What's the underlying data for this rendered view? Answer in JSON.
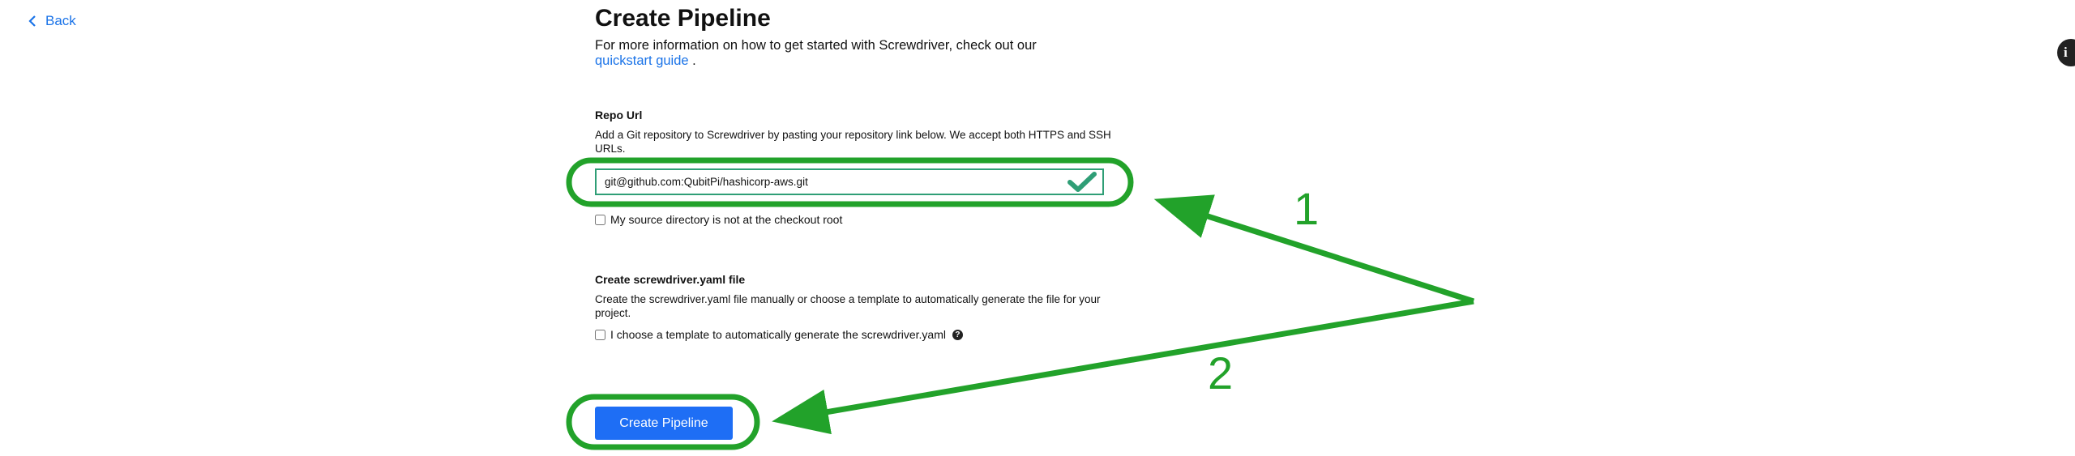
{
  "nav": {
    "back_label": "Back"
  },
  "header": {
    "title": "Create Pipeline",
    "intro_text": "For more information on how to get started with Screwdriver, check out our ",
    "intro_link": "quickstart guide",
    "intro_suffix": " ."
  },
  "repo": {
    "label": "Repo Url",
    "description": "Add a Git repository to Screwdriver by pasting your repository link below. We accept both HTTPS and SSH URLs.",
    "value": "git@github.com:QubitPi/hashicorp-aws.git",
    "valid_icon": "checkmark-icon",
    "source_dir_checkbox_label": "My source directory is not at the checkout root",
    "source_dir_checked": false
  },
  "yaml": {
    "label": "Create screwdriver.yaml file",
    "description": "Create the screwdriver.yaml file manually or choose a template to automatically generate the file for your project.",
    "template_checkbox_label": "I choose a template to automatically generate the screwdriver.yaml",
    "template_checked": false,
    "help_icon": "question-circle-icon"
  },
  "actions": {
    "create_label": "Create Pipeline"
  },
  "info_fab": {
    "icon": "info-icon",
    "glyph": "i"
  },
  "annotations": {
    "marker_1": "1",
    "marker_2": "2",
    "color": "#22a22a"
  },
  "colors": {
    "link": "#1a73e8",
    "primary_button": "#1e6ef5",
    "valid_border": "#2f9e76"
  }
}
